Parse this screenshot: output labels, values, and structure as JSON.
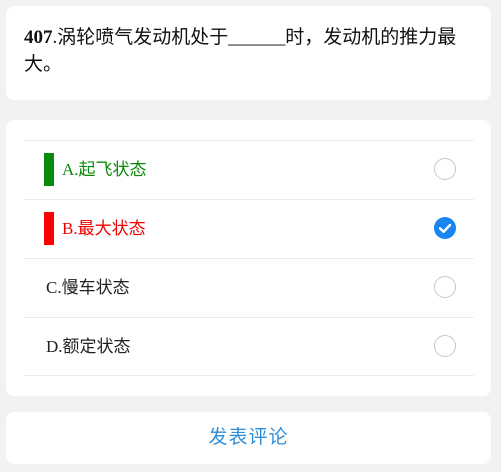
{
  "question": {
    "number": "407",
    "text": ".涡轮喷气发动机处于______时，发动机的推力最大。"
  },
  "options": [
    {
      "label": "A.起飞状态",
      "marker": "correct",
      "selected": false,
      "checkbox_icon": "empty-circle-icon"
    },
    {
      "label": "B.最大状态",
      "marker": "wrong",
      "selected": true,
      "checkbox_icon": "checked-circle-icon"
    },
    {
      "label": "C.慢车状态",
      "marker": "none",
      "selected": false,
      "checkbox_icon": "empty-circle-icon"
    },
    {
      "label": "D.额定状态",
      "marker": "none",
      "selected": false,
      "checkbox_icon": "empty-circle-icon"
    }
  ],
  "comment_button": {
    "label": "发表评论"
  },
  "colors": {
    "correct": "#0a8a0a",
    "wrong": "#ff0000",
    "selected": "#1a84f0",
    "link": "#2e8ed8",
    "background": "#f2f2f2"
  }
}
